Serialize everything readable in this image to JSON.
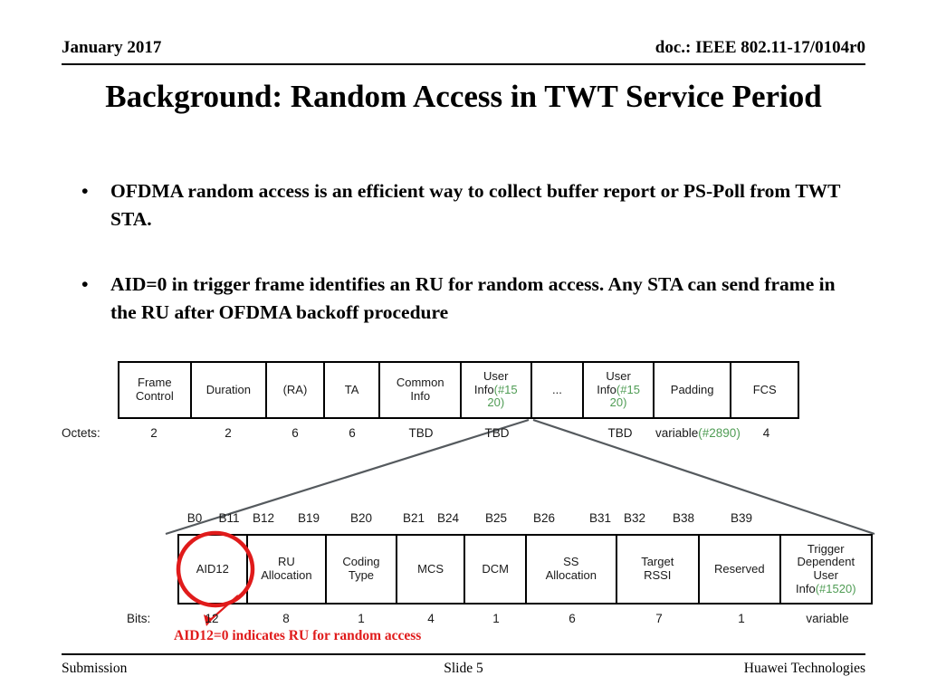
{
  "header": {
    "date": "January 2017",
    "doc": "doc.: IEEE 802.11-17/0104r0"
  },
  "title": "Background: Random Access in TWT Service Period",
  "bullets": [
    {
      "marker": "•",
      "text": "OFDMA random access is an efficient way to collect buffer report or PS-Poll from TWT STA."
    },
    {
      "marker": "•",
      "text": "AID=0 in trigger frame identifies an RU for random access. Any STA can send frame in the RU after OFDMA backoff procedure"
    }
  ],
  "trigger_frame": {
    "row_label": "Octets:",
    "cells": [
      {
        "line1": "Frame",
        "line2": "Control",
        "green": "",
        "octets": "2",
        "octets_green": ""
      },
      {
        "line1": "Duration",
        "line2": "",
        "green": "",
        "octets": "2",
        "octets_green": ""
      },
      {
        "line1": "(RA)",
        "line2": "",
        "green": "",
        "octets": "6",
        "octets_green": ""
      },
      {
        "line1": "TA",
        "line2": "",
        "green": "",
        "octets": "6",
        "octets_green": ""
      },
      {
        "line1": "Common",
        "line2": "Info",
        "green": "",
        "octets": "TBD",
        "octets_green": ""
      },
      {
        "line1": "User",
        "line2": "Info",
        "green": "(#1520)",
        "octets": "TBD",
        "octets_green": ""
      },
      {
        "line1": "...",
        "line2": "",
        "green": "",
        "octets": "",
        "octets_green": ""
      },
      {
        "line1": "User",
        "line2": "Info",
        "green": "(#1520)",
        "octets": "TBD",
        "octets_green": ""
      },
      {
        "line1": "Padding",
        "line2": "",
        "green": "",
        "octets": "variable",
        "octets_green": "(#2890)"
      },
      {
        "line1": "FCS",
        "line2": "",
        "green": "",
        "octets": "4",
        "octets_green": ""
      }
    ]
  },
  "user_info_field": {
    "row_label": "Bits:",
    "bit_labels": [
      "B0",
      "B11",
      "B12",
      "B19",
      "B20",
      "B21",
      "B24",
      "B25",
      "B26",
      "B31",
      "B32",
      "B38",
      "B39"
    ],
    "cells": [
      {
        "line1": "AID12",
        "line2": "",
        "line3": "",
        "green": "",
        "bits": "12"
      },
      {
        "line1": "RU",
        "line2": "Allocation",
        "line3": "",
        "green": "",
        "bits": "8"
      },
      {
        "line1": "Coding",
        "line2": "Type",
        "line3": "",
        "green": "",
        "bits": "1"
      },
      {
        "line1": "MCS",
        "line2": "",
        "line3": "",
        "green": "",
        "bits": "4"
      },
      {
        "line1": "DCM",
        "line2": "",
        "line3": "",
        "green": "",
        "bits": "1"
      },
      {
        "line1": "SS",
        "line2": "Allocation",
        "line3": "",
        "green": "",
        "bits": "6"
      },
      {
        "line1": "Target",
        "line2": "RSSI",
        "line3": "",
        "green": "",
        "bits": "7"
      },
      {
        "line1": "Reserved",
        "line2": "",
        "line3": "",
        "green": "",
        "bits": "1"
      },
      {
        "line1": "Trigger",
        "line2": "Dependent",
        "line3": "User",
        "green": "Info(#1520)",
        "bits": "variable"
      }
    ]
  },
  "annotation": {
    "caption": "AID12=0 indicates RU for random access",
    "highlight_color": "#e01b1b",
    "note_color": "#4f9c54"
  },
  "footer": {
    "left": "Submission",
    "center": "Slide 5",
    "right": "Huawei Technologies"
  }
}
